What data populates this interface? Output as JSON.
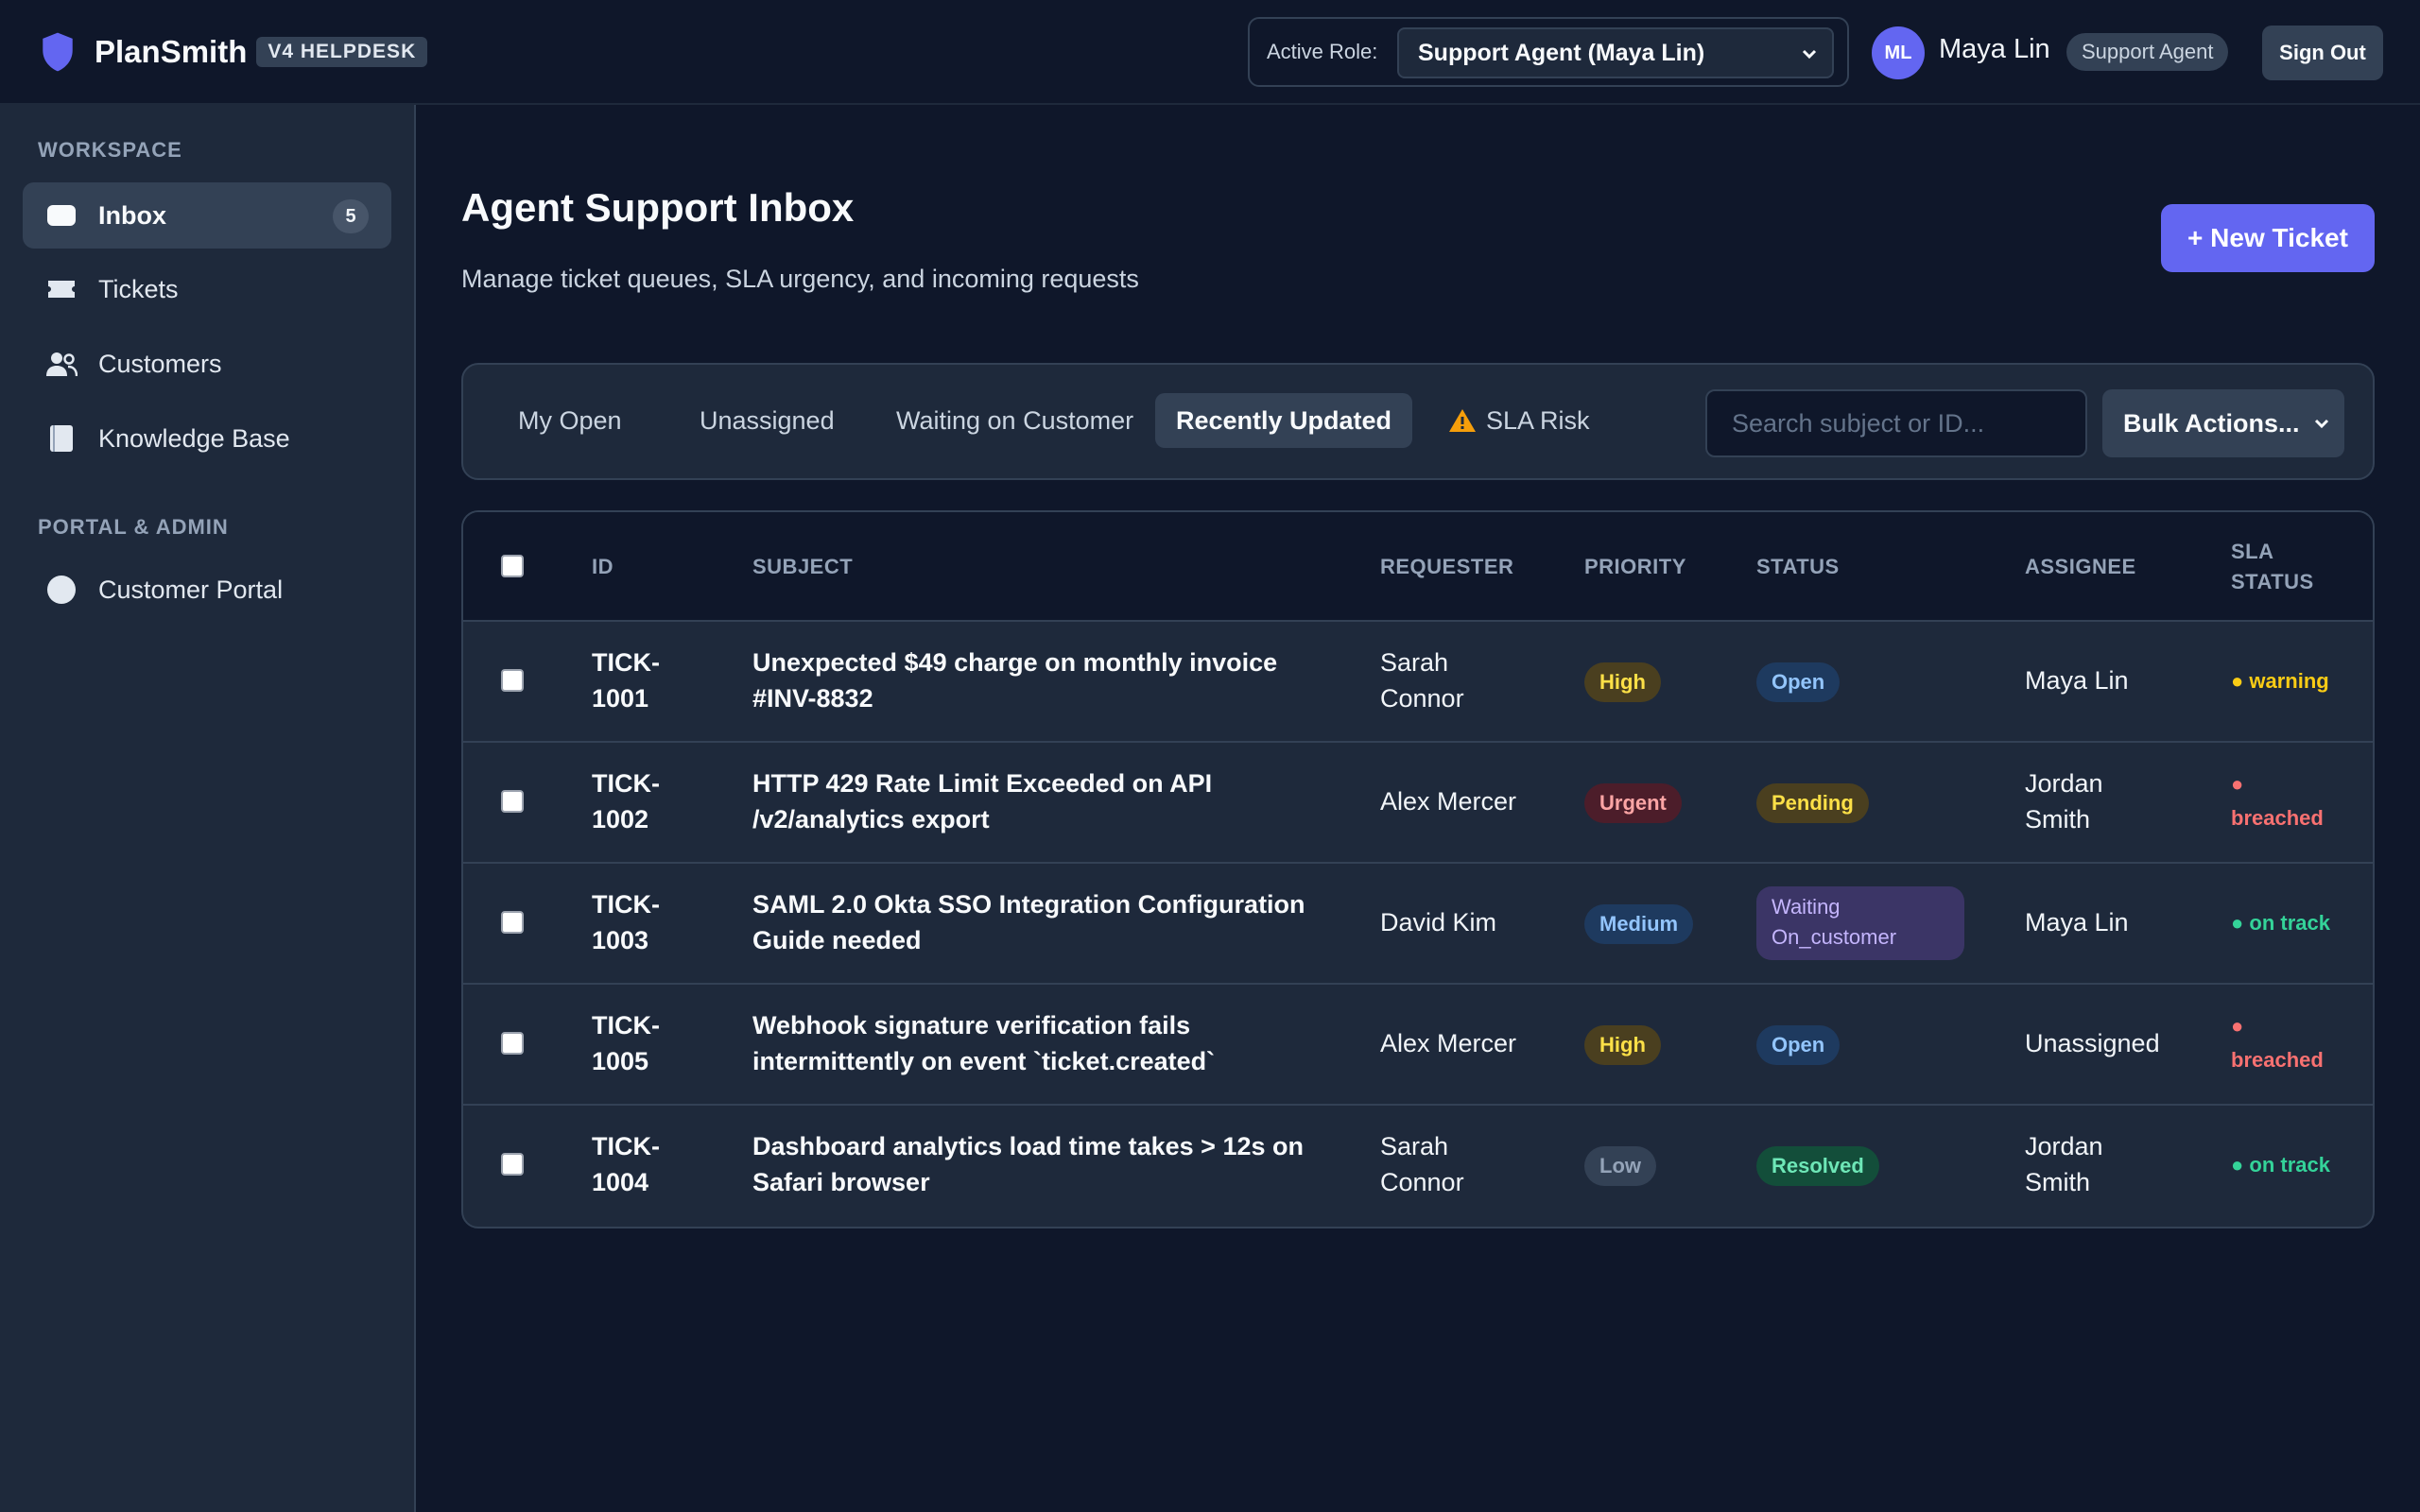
{
  "header": {
    "brand": "PlanSmith",
    "brand_tag": "V4 HELPDESK",
    "role_label": "Active Role:",
    "role_value": "Support Agent (Maya Lin)",
    "avatar_initials": "ML",
    "user_name": "Maya Lin",
    "user_role": "Support Agent",
    "sign_out": "Sign Out",
    "brand_color": "#6366f1"
  },
  "sidebar": {
    "section1": "WORKSPACE",
    "section2": "PORTAL & ADMIN",
    "items": [
      {
        "label": "Inbox",
        "icon": "inbox-icon",
        "count": "5",
        "active": true
      },
      {
        "label": "Tickets",
        "icon": "ticket-icon"
      },
      {
        "label": "Customers",
        "icon": "users-icon"
      },
      {
        "label": "Knowledge Base",
        "icon": "book-icon"
      },
      {
        "label": "Customer Portal",
        "icon": "globe-icon"
      }
    ]
  },
  "main": {
    "title": "Agent Support Inbox",
    "subtitle": "Manage ticket queues, SLA urgency, and incoming requests",
    "new_ticket": "+ New Ticket",
    "tabs": [
      {
        "label": "My Open"
      },
      {
        "label": "Unassigned"
      },
      {
        "label": "Waiting on Customer"
      },
      {
        "label": "Recently Updated",
        "active": true
      },
      {
        "label": "SLA Risk",
        "icon": "warning-icon"
      }
    ],
    "search_placeholder": "Search subject or ID...",
    "bulk_actions": "Bulk Actions..."
  },
  "table": {
    "columns": [
      "ID",
      "SUBJECT",
      "REQUESTER",
      "PRIORITY",
      "STATUS",
      "ASSIGNEE",
      "SLA",
      "STATUS"
    ],
    "rows": [
      {
        "id1": "TICK-",
        "id2": "1001",
        "subj1": "Unexpected $49 charge on monthly invoice",
        "subj2": "#INV-8832",
        "req1": "Sarah",
        "req2": "Connor",
        "priority": "High",
        "status1": "Open",
        "status2": "",
        "asg1": "Maya Lin",
        "asg2": "",
        "sla1": "",
        "sla2": "● warning"
      },
      {
        "id1": "TICK-",
        "id2": "1002",
        "subj1": "HTTP 429 Rate Limit Exceeded on API",
        "subj2": "/v2/analytics export",
        "req1": "Alex Mercer",
        "req2": "",
        "priority": "Urgent",
        "status1": "Pending",
        "status2": "",
        "asg1": "Jordan",
        "asg2": "Smith",
        "sla1": "●",
        "sla2": "breached"
      },
      {
        "id1": "TICK-",
        "id2": "1003",
        "subj1": "SAML 2.0 Okta SSO Integration Configuration",
        "subj2": "Guide needed",
        "req1": "David Kim",
        "req2": "",
        "priority": "Medium",
        "status1": "Waiting",
        "status2": "On_customer",
        "asg1": "Maya Lin",
        "asg2": "",
        "sla1": "",
        "sla2": "● on track"
      },
      {
        "id1": "TICK-",
        "id2": "1005",
        "subj1": "Webhook signature verification fails",
        "subj2": "intermittently on event `ticket.created`",
        "req1": "Alex Mercer",
        "req2": "",
        "priority": "High",
        "status1": "Open",
        "status2": "",
        "asg1": "Unassigned",
        "asg2": "",
        "sla1": "●",
        "sla2": "breached"
      },
      {
        "id1": "TICK-",
        "id2": "1004",
        "subj1": "Dashboard analytics load time takes > 12s on",
        "subj2": "Safari browser",
        "req1": "Sarah",
        "req2": "Connor",
        "priority": "Low",
        "status1": "Resolved",
        "status2": "",
        "asg1": "Jordan",
        "asg2": "Smith",
        "sla1": "",
        "sla2": "● on track"
      }
    ]
  },
  "colors": {
    "high": "#fde047",
    "urgent": "#fca5a5",
    "medium": "#93c5fd",
    "low": "#94a3b8",
    "open": "#93c5fd",
    "pending": "#fde047",
    "waiting": "#c4b5fd",
    "resolved": "#6ee7b7",
    "sla_warning": "#facc15",
    "sla_breached": "#f87171",
    "sla_on_track": "#34d399"
  }
}
